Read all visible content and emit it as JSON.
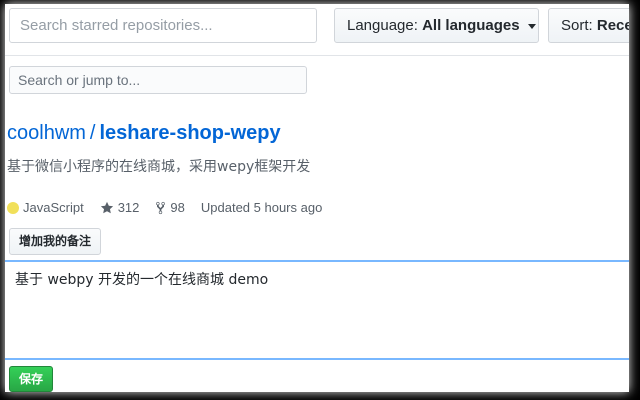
{
  "filters": {
    "star_search_placeholder": "Search starred repositories...",
    "language_label": "Language:",
    "language_value": "All languages",
    "sort_label": "Sort:",
    "sort_value": "Recently starred"
  },
  "jump_search": {
    "placeholder": "Search or jump to..."
  },
  "repo": {
    "owner": "coolhwm",
    "separator": "/",
    "name": "leshare-shop-wepy",
    "description": "基于微信小程序的在线商城，采用wepy框架开发",
    "language": "JavaScript",
    "language_color": "#f1e05a",
    "stars": "312",
    "forks": "98",
    "updated": "Updated 5 hours ago"
  },
  "note": {
    "add_button_label": "增加我的备注",
    "text": "基于 webpy 开发的一个在线商城 demo",
    "save_label": "保存"
  },
  "colors": {
    "link": "#0366d6",
    "save_green": "#28a745",
    "focus_border": "#79b8ff"
  }
}
